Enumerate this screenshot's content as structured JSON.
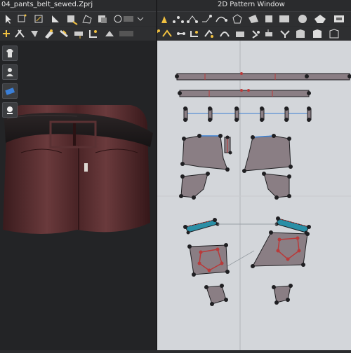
{
  "window": {
    "file_title": "04_pants_belt_sewed.Zprj",
    "pattern_window_title": "2D Pattern Window"
  },
  "icons": {
    "side_tools": [
      "shirt-icon",
      "avatar-icon",
      "fabric-icon",
      "avatar-head-icon"
    ],
    "toolbar_3d_row1": [
      "select-icon",
      "move-icon",
      "transform-icon",
      "edit-pattern-icon",
      "add-point-icon",
      "polygon-icon",
      "rectangle-icon",
      "circle-icon"
    ],
    "toolbar_3d_row2": [
      "segment-sewing-icon",
      "free-sewing-icon",
      "fold-icon",
      "tack-icon",
      "pin-icon",
      "measure-icon",
      "zipper-icon",
      "button-icon"
    ],
    "toolbar_2d_row1": [
      "arrow-icon",
      "edit-point-icon",
      "curve-point-icon",
      "edit-curvature-icon",
      "add-point-icon",
      "curve-icon",
      "polygon-icon",
      "rectangle-icon",
      "circle-icon",
      "ellipse-icon",
      "internal-line-icon"
    ],
    "toolbar_2d_row2": [
      "segment-sewing-icon",
      "free-sewing-icon",
      "check-sewing-icon",
      "fold-arrangement-icon",
      "tack-icon",
      "zipper-icon",
      "button-icon",
      "buttonhole-icon",
      "topstitch-icon",
      "puckering-icon",
      "trim-icon"
    ]
  },
  "colors": {
    "pattern_fill": "#8a7e84",
    "pattern_outline": "#1f1f22",
    "seam_red": "#b93a3a",
    "seam_blue": "#3b7fd1",
    "waistband_teal": "#2a8fa6",
    "pants_leather": "#4a2426",
    "belt": "#1e1a1b"
  }
}
